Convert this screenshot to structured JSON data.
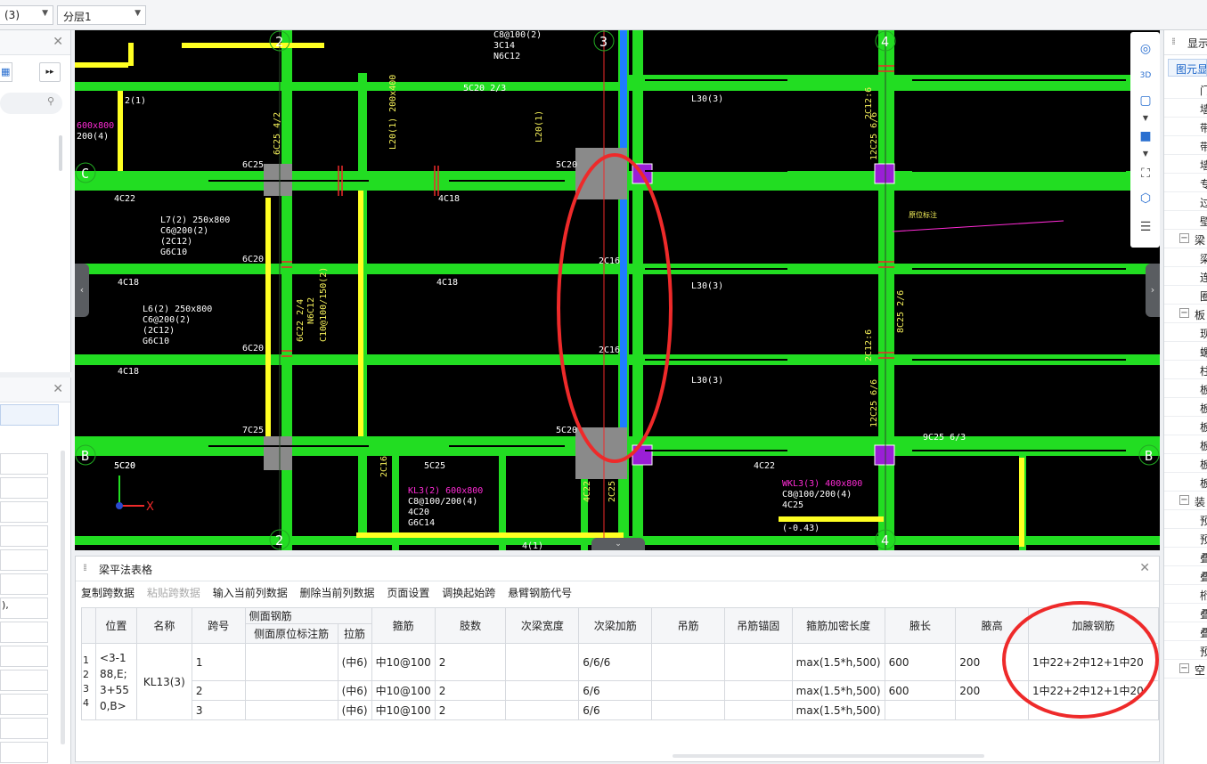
{
  "toolbar": {
    "floor_value": "(3)",
    "layer_value": "分层1"
  },
  "canvas": {
    "axes": {
      "x": "X"
    },
    "grid_labels": [
      "2",
      "3",
      "4",
      "C",
      "B",
      "2",
      "4",
      "B"
    ],
    "beam_labels": [
      "6C25",
      "4C22",
      "L7(2) 250x800",
      "C6@200(2)",
      "(2C12)",
      "G6C10",
      "6C20",
      "4C18",
      "L6(2) 250x800",
      "C6@200(2)",
      "(2C12)",
      "G6C10",
      "6C20",
      "4C18",
      "7C25",
      "5C20",
      "5C20 2/3",
      "5C20",
      "5C20",
      "4C18",
      "2C16",
      "2C16",
      "4C18",
      "L30(3)",
      "L30(3)",
      "L30(3)",
      "5C20",
      "5C25",
      "4C22",
      "9C25 6/3",
      "WKL3(3) 400x800",
      "C8@100/200(4)",
      "4C25",
      "(-0.43)",
      "KL3(2) 600x800",
      "C8@100/200(4)",
      "4C20",
      "G6C14",
      "600x800",
      "200(4)",
      "2(1)",
      "L20(1) 200x400",
      "L20(1)",
      "4(1)",
      "C8@100(2)",
      "3C14",
      "N6C12",
      "2C12:6",
      "12C25 6/6",
      "8C25 2/6",
      "2C12:6",
      "12C25 6/6",
      "6C25 4/2",
      "6C22 2/4",
      "N6C12",
      "C10@100/150(2)",
      "2C16",
      "4C22",
      "2C25",
      "L4(1)"
    ],
    "callout_text": "原位标注"
  },
  "beam_table": {
    "title": "梁平法表格",
    "toolbar": [
      "复制跨数据",
      "粘贴跨数据",
      "输入当前列数据",
      "删除当前列数据",
      "页面设置",
      "调换起始跨",
      "悬臂钢筋代号"
    ],
    "headers": {
      "position": "位置",
      "name": "名称",
      "span": "跨号",
      "side_rebar": "侧面钢筋",
      "side_mark": "侧面原位标注筋",
      "tie": "拉筋",
      "stirrup": "箍筋",
      "legs": "肢数",
      "sub_width": "次梁宽度",
      "sub_add": "次梁加筋",
      "hanger": "吊筋",
      "hanger_anchor": "吊筋锚固",
      "dense_len": "箍筋加密长度",
      "haunch_len": "腋长",
      "haunch_h": "腋高",
      "haunch_rebar": "加腋钢筋"
    },
    "row_numbers": [
      "1",
      "2",
      "3",
      "4"
    ],
    "position_text": "<3-188,E;3+550,B>",
    "name_text": "KL13(3)",
    "rows": [
      {
        "span": "1",
        "tie": "(中6)",
        "stirrup": "中10@100",
        "legs": "2",
        "sub_add": "6/6/6",
        "dense_len": "max(1.5*h,500)",
        "haunch_len": "600",
        "haunch_h": "200",
        "haunch_rebar": "1中22+2中12+1中20"
      },
      {
        "span": "2",
        "tie": "(中6)",
        "stirrup": "中10@100",
        "legs": "2",
        "sub_add": "6/6",
        "dense_len": "max(1.5*h,500)",
        "haunch_len": "600",
        "haunch_h": "200",
        "haunch_rebar": "1中22+2中12+1中20"
      },
      {
        "span": "3",
        "tie": "(中6)",
        "stirrup": "中10@100",
        "legs": "2",
        "sub_add": "6/6",
        "dense_len": "max(1.5*h,500)",
        "haunch_len": "",
        "haunch_h": "",
        "haunch_rebar": ""
      }
    ]
  },
  "right_panel": {
    "title": "显示",
    "tab": "图元显示",
    "groups": [
      {
        "type": "item",
        "label": "门"
      },
      {
        "type": "item",
        "label": "墙"
      },
      {
        "type": "item",
        "label": "带"
      },
      {
        "type": "item",
        "label": "带"
      },
      {
        "type": "item",
        "label": "墙"
      },
      {
        "type": "item",
        "label": "专"
      },
      {
        "type": "item",
        "label": "过"
      },
      {
        "type": "item",
        "label": "壁"
      },
      {
        "type": "group",
        "label": "梁"
      },
      {
        "type": "item",
        "label": "梁"
      },
      {
        "type": "item",
        "label": "连"
      },
      {
        "type": "item",
        "label": "圈"
      },
      {
        "type": "group",
        "label": "板"
      },
      {
        "type": "item",
        "label": "现"
      },
      {
        "type": "item",
        "label": "螺"
      },
      {
        "type": "item",
        "label": "柱"
      },
      {
        "type": "item",
        "label": "板"
      },
      {
        "type": "item",
        "label": "板"
      },
      {
        "type": "item",
        "label": "板"
      },
      {
        "type": "item",
        "label": "板"
      },
      {
        "type": "item",
        "label": "板"
      },
      {
        "type": "item",
        "label": "板"
      },
      {
        "type": "group",
        "label": "装"
      },
      {
        "type": "item",
        "label": "预"
      },
      {
        "type": "item",
        "label": "预"
      },
      {
        "type": "item",
        "label": "叠"
      },
      {
        "type": "item",
        "label": "叠"
      },
      {
        "type": "item",
        "label": "桁"
      },
      {
        "type": "item",
        "label": "叠"
      },
      {
        "type": "item",
        "label": "叠"
      },
      {
        "type": "item",
        "label": "预"
      },
      {
        "type": "group",
        "label": "空"
      }
    ]
  },
  "left_panels": {
    "list_value": "),"
  },
  "colors": {
    "beam_green": "#22dd22",
    "column_yellow": "#ffff22",
    "annotation_red": "#ee2a2a",
    "column_gray": "#8a8a8a",
    "column_purple": "#9a1fd6",
    "text_yellow": "#f5f05a",
    "text_magenta": "#ff2bd6",
    "blue_beam": "#1e7cff"
  }
}
